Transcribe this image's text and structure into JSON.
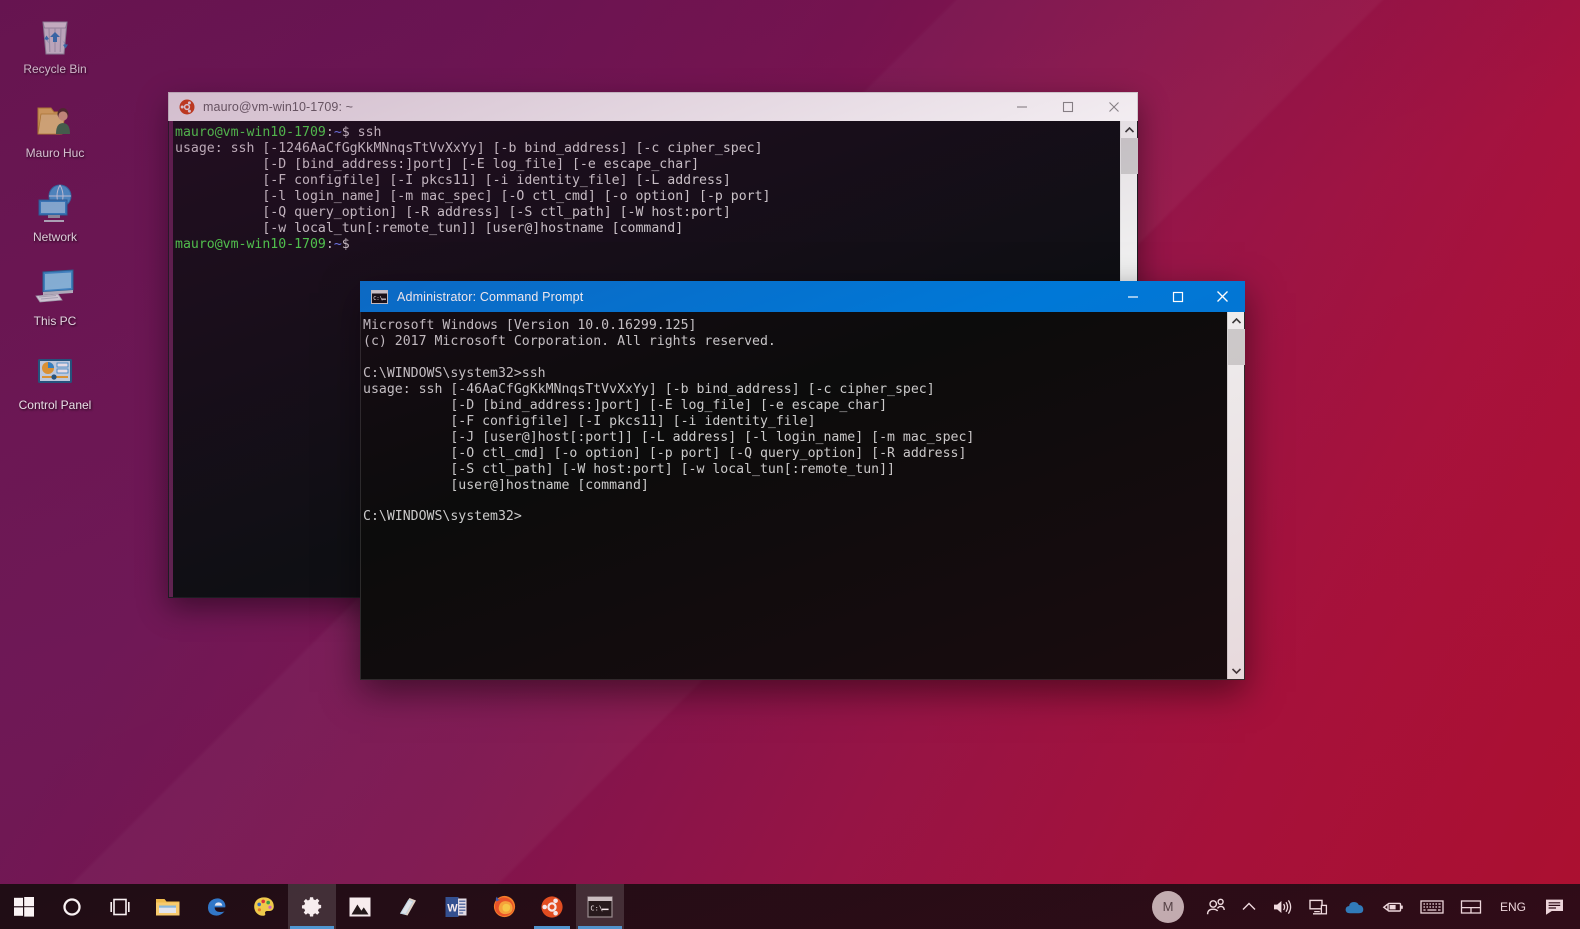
{
  "desktop": {
    "icons": [
      {
        "label": "Recycle Bin",
        "icon": "recycle-bin-icon"
      },
      {
        "label": "Mauro Huc",
        "icon": "user-folder-icon"
      },
      {
        "label": "Network",
        "icon": "network-icon"
      },
      {
        "label": "This PC",
        "icon": "this-pc-icon"
      },
      {
        "label": "Control Panel",
        "icon": "control-panel-icon"
      }
    ],
    "wallpaper_colors": {
      "purple": "#6d1a55",
      "crimson": "#b01132"
    }
  },
  "wsl_window": {
    "title": "mauro@vm-win10-1709: ~",
    "icon": "ubuntu-logo-icon",
    "minimize_label": "Minimize",
    "maximize_label": "Maximize",
    "close_label": "Close",
    "accent_color": "#5f2350",
    "prompt_user": "mauro@vm-win10-1709",
    "prompt_path": "~",
    "lines": [
      {
        "type": "prompt",
        "command": " ssh"
      },
      {
        "type": "out",
        "text": "usage: ssh [-1246AaCfGgKkMNnqsTtVvXxYy] [-b bind_address] [-c cipher_spec]"
      },
      {
        "type": "out",
        "text": "           [-D [bind_address:]port] [-E log_file] [-e escape_char]"
      },
      {
        "type": "out",
        "text": "           [-F configfile] [-I pkcs11] [-i identity_file] [-L address]"
      },
      {
        "type": "out",
        "text": "           [-l login_name] [-m mac_spec] [-O ctl_cmd] [-o option] [-p port]"
      },
      {
        "type": "out",
        "text": "           [-Q query_option] [-R address] [-S ctl_path] [-W host:port]"
      },
      {
        "type": "out",
        "text": "           [-w local_tun[:remote_tun]] [user@]hostname [command]"
      },
      {
        "type": "prompt",
        "command": ""
      }
    ]
  },
  "cmd_window": {
    "title": "Administrator: Command Prompt",
    "icon": "command-prompt-icon",
    "minimize_label": "Minimize",
    "maximize_label": "Maximize",
    "close_label": "Close",
    "accent_color": "#0078d7",
    "lines": [
      "Microsoft Windows [Version 10.0.16299.125]",
      "(c) 2017 Microsoft Corporation. All rights reserved.",
      "",
      "C:\\WINDOWS\\system32>ssh",
      "usage: ssh [-46AaCfGgKkMNnqsTtVvXxYy] [-b bind_address] [-c cipher_spec]",
      "           [-D [bind_address:]port] [-E log_file] [-e escape_char]",
      "           [-F configfile] [-I pkcs11] [-i identity_file]",
      "           [-J [user@]host[:port]] [-L address] [-l login_name] [-m mac_spec]",
      "           [-O ctl_cmd] [-o option] [-p port] [-Q query_option] [-R address]",
      "           [-S ctl_path] [-W host:port] [-w local_tun[:remote_tun]]",
      "           [user@]hostname [command]",
      "",
      "C:\\WINDOWS\\system32>"
    ]
  },
  "taskbar": {
    "items": [
      {
        "name": "start-button",
        "icon": "windows-logo-icon",
        "active": false,
        "running": false
      },
      {
        "name": "cortana-button",
        "icon": "cortana-circle-icon",
        "active": false,
        "running": false
      },
      {
        "name": "task-view-button",
        "icon": "task-view-icon",
        "active": false,
        "running": false
      },
      {
        "name": "file-explorer-button",
        "icon": "file-explorer-icon",
        "active": false,
        "running": true
      },
      {
        "name": "edge-button",
        "icon": "edge-icon",
        "active": false,
        "running": false
      },
      {
        "name": "paint-button",
        "icon": "paint-palette-icon",
        "active": false,
        "running": true
      },
      {
        "name": "settings-button",
        "icon": "gear-icon",
        "active": true,
        "running": true
      },
      {
        "name": "photos-button",
        "icon": "photos-icon",
        "active": false,
        "running": false
      },
      {
        "name": "sticky-notes-button",
        "icon": "sticky-notes-icon",
        "active": false,
        "running": false
      },
      {
        "name": "word-button",
        "icon": "word-icon",
        "active": false,
        "running": false
      },
      {
        "name": "firefox-button",
        "icon": "firefox-icon",
        "active": false,
        "running": false
      },
      {
        "name": "ubuntu-button",
        "icon": "ubuntu-icon",
        "active": false,
        "running": true
      },
      {
        "name": "command-prompt-button",
        "icon": "command-prompt-icon",
        "active": true,
        "running": true
      }
    ],
    "tray": {
      "user_initial": "M",
      "icons": [
        {
          "name": "people-icon"
        },
        {
          "name": "show-hidden-icons-chevron"
        },
        {
          "name": "volume-icon"
        },
        {
          "name": "network-icon"
        },
        {
          "name": "onedrive-icon"
        },
        {
          "name": "battery-icon"
        },
        {
          "name": "touch-keyboard-icon"
        },
        {
          "name": "touchpad-icon"
        }
      ],
      "language": "ENG",
      "action_center": "action-center-icon"
    }
  }
}
